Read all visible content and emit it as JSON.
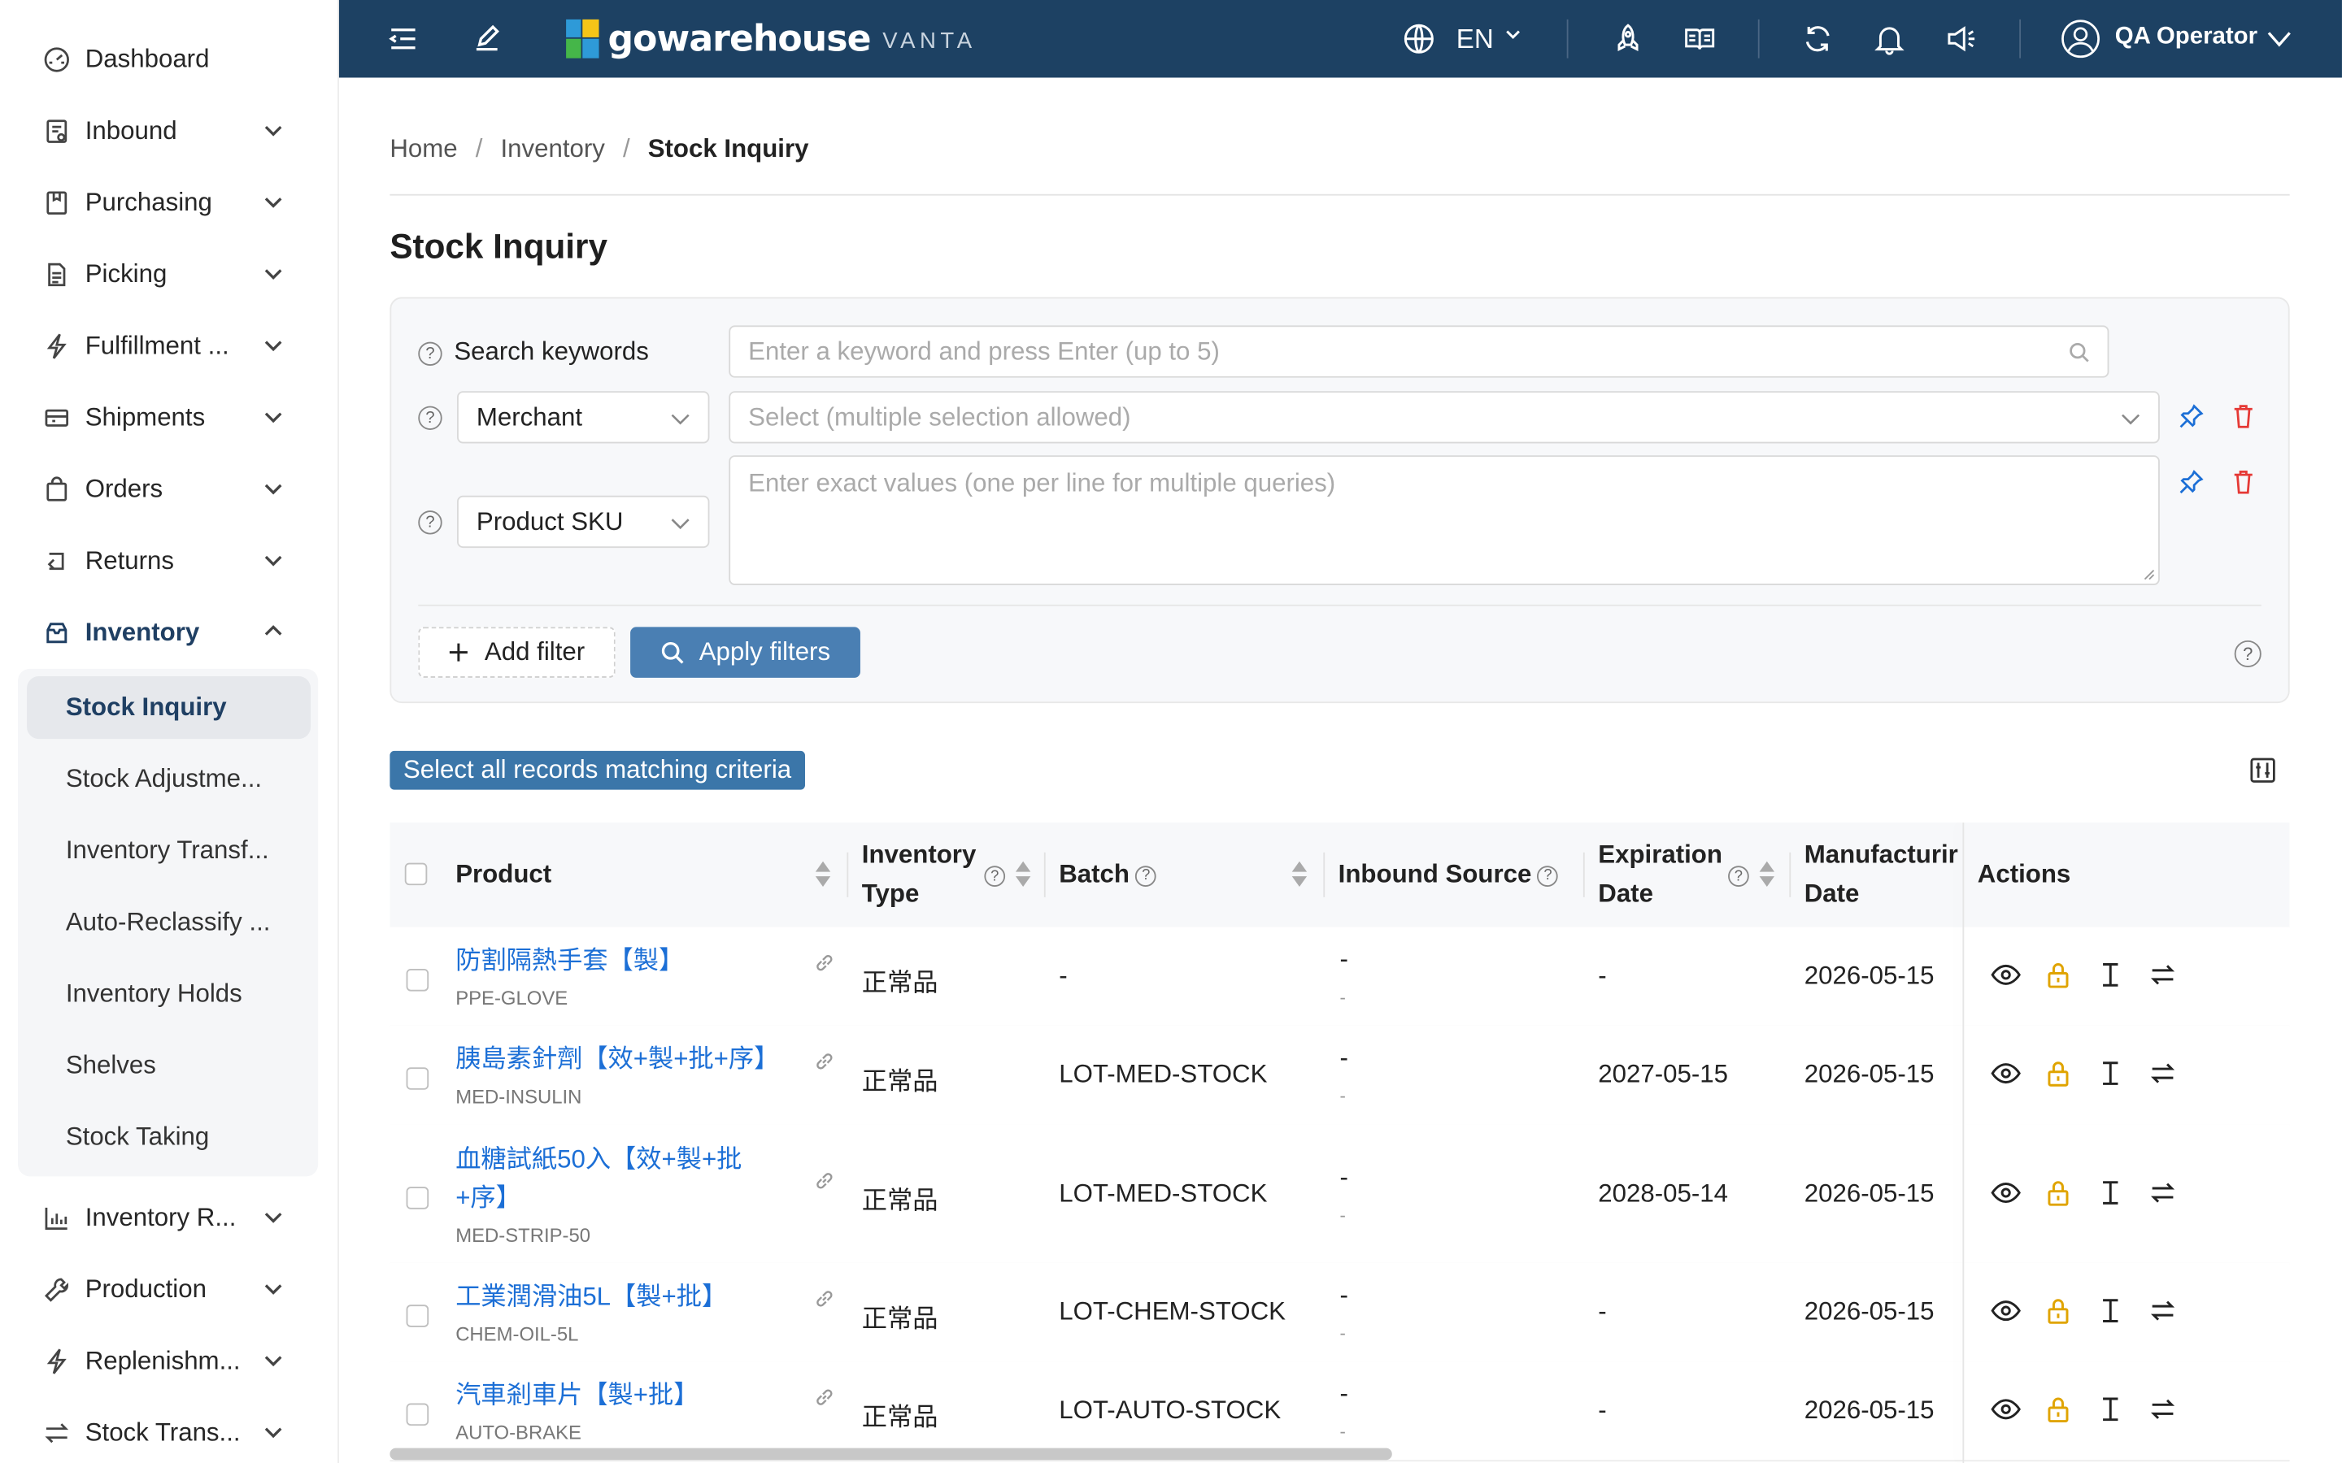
{
  "sidebar": {
    "items": [
      {
        "label": "Dashboard"
      },
      {
        "label": "Inbound"
      },
      {
        "label": "Purchasing"
      },
      {
        "label": "Picking"
      },
      {
        "label": "Fulfillment ..."
      },
      {
        "label": "Shipments"
      },
      {
        "label": "Orders"
      },
      {
        "label": "Returns"
      },
      {
        "label": "Inventory"
      },
      {
        "label": "Inventory R..."
      },
      {
        "label": "Production"
      },
      {
        "label": "Replenishm..."
      },
      {
        "label": "Stock Trans..."
      }
    ],
    "inventory_sub": [
      {
        "label": "Stock Inquiry"
      },
      {
        "label": "Stock Adjustme..."
      },
      {
        "label": "Inventory Transf..."
      },
      {
        "label": "Auto-Reclassify ..."
      },
      {
        "label": "Inventory Holds"
      },
      {
        "label": "Shelves"
      },
      {
        "label": "Stock Taking"
      }
    ]
  },
  "topbar": {
    "brand": "gowarehouse",
    "brand_sub": "VANTA",
    "lang": "EN",
    "user": "QA Operator"
  },
  "breadcrumb": {
    "home": "Home",
    "section": "Inventory",
    "current": "Stock Inquiry",
    "sep": "/"
  },
  "page": {
    "title": "Stock Inquiry"
  },
  "filters": {
    "keywords_label": "Search keywords",
    "keywords_placeholder": "Enter a keyword and press Enter (up to 5)",
    "merchant_field": "Merchant",
    "merchant_placeholder": "Select (multiple selection allowed)",
    "sku_field": "Product SKU",
    "sku_placeholder": "Enter exact values (one per line for multiple queries)",
    "add_filter": "Add filter",
    "apply": "Apply filters"
  },
  "toolbar": {
    "select_all": "Select all records matching criteria"
  },
  "table": {
    "headers": {
      "product": "Product",
      "inventory_type_1": "Inventory",
      "inventory_type_2": "Type",
      "batch": "Batch",
      "inbound_source": "Inbound Source",
      "expiration_1": "Expiration",
      "expiration_2": "Date",
      "manufacturing_1": "Manufacturir",
      "manufacturing_2": "Date",
      "actions": "Actions"
    },
    "rows": [
      {
        "name": "防割隔熱手套【製】",
        "sku": "PPE-GLOVE",
        "type": "正常品",
        "batch": "-",
        "source": "-",
        "source_sub": "-",
        "exp": "-",
        "mfg": "2026-05-15"
      },
      {
        "name": "胰島素針劑【效+製+批+序】",
        "sku": "MED-INSULIN",
        "type": "正常品",
        "batch": "LOT-MED-STOCK",
        "source": "-",
        "source_sub": "-",
        "exp": "2027-05-15",
        "mfg": "2026-05-15"
      },
      {
        "name": "血糖試紙50入【效+製+批+序】",
        "sku": "MED-STRIP-50",
        "type": "正常品",
        "batch": "LOT-MED-STOCK",
        "source": "-",
        "source_sub": "-",
        "exp": "2028-05-14",
        "mfg": "2026-05-15"
      },
      {
        "name": "工業潤滑油5L【製+批】",
        "sku": "CHEM-OIL-5L",
        "type": "正常品",
        "batch": "LOT-CHEM-STOCK",
        "source": "-",
        "source_sub": "-",
        "exp": "-",
        "mfg": "2026-05-15"
      },
      {
        "name": "汽車剎車片【製+批】",
        "sku": "AUTO-BRAKE",
        "type": "正常品",
        "batch": "LOT-AUTO-STOCK",
        "source": "-",
        "source_sub": "-",
        "exp": "-",
        "mfg": "2026-05-15"
      }
    ]
  },
  "colors": {
    "topbar": "#1d4163",
    "primary_button": "#4a7fb3",
    "link": "#1c6fd6",
    "lock_icon": "#e0a400",
    "delete_icon": "#e53935",
    "pin_icon": "#1c6fd6"
  }
}
